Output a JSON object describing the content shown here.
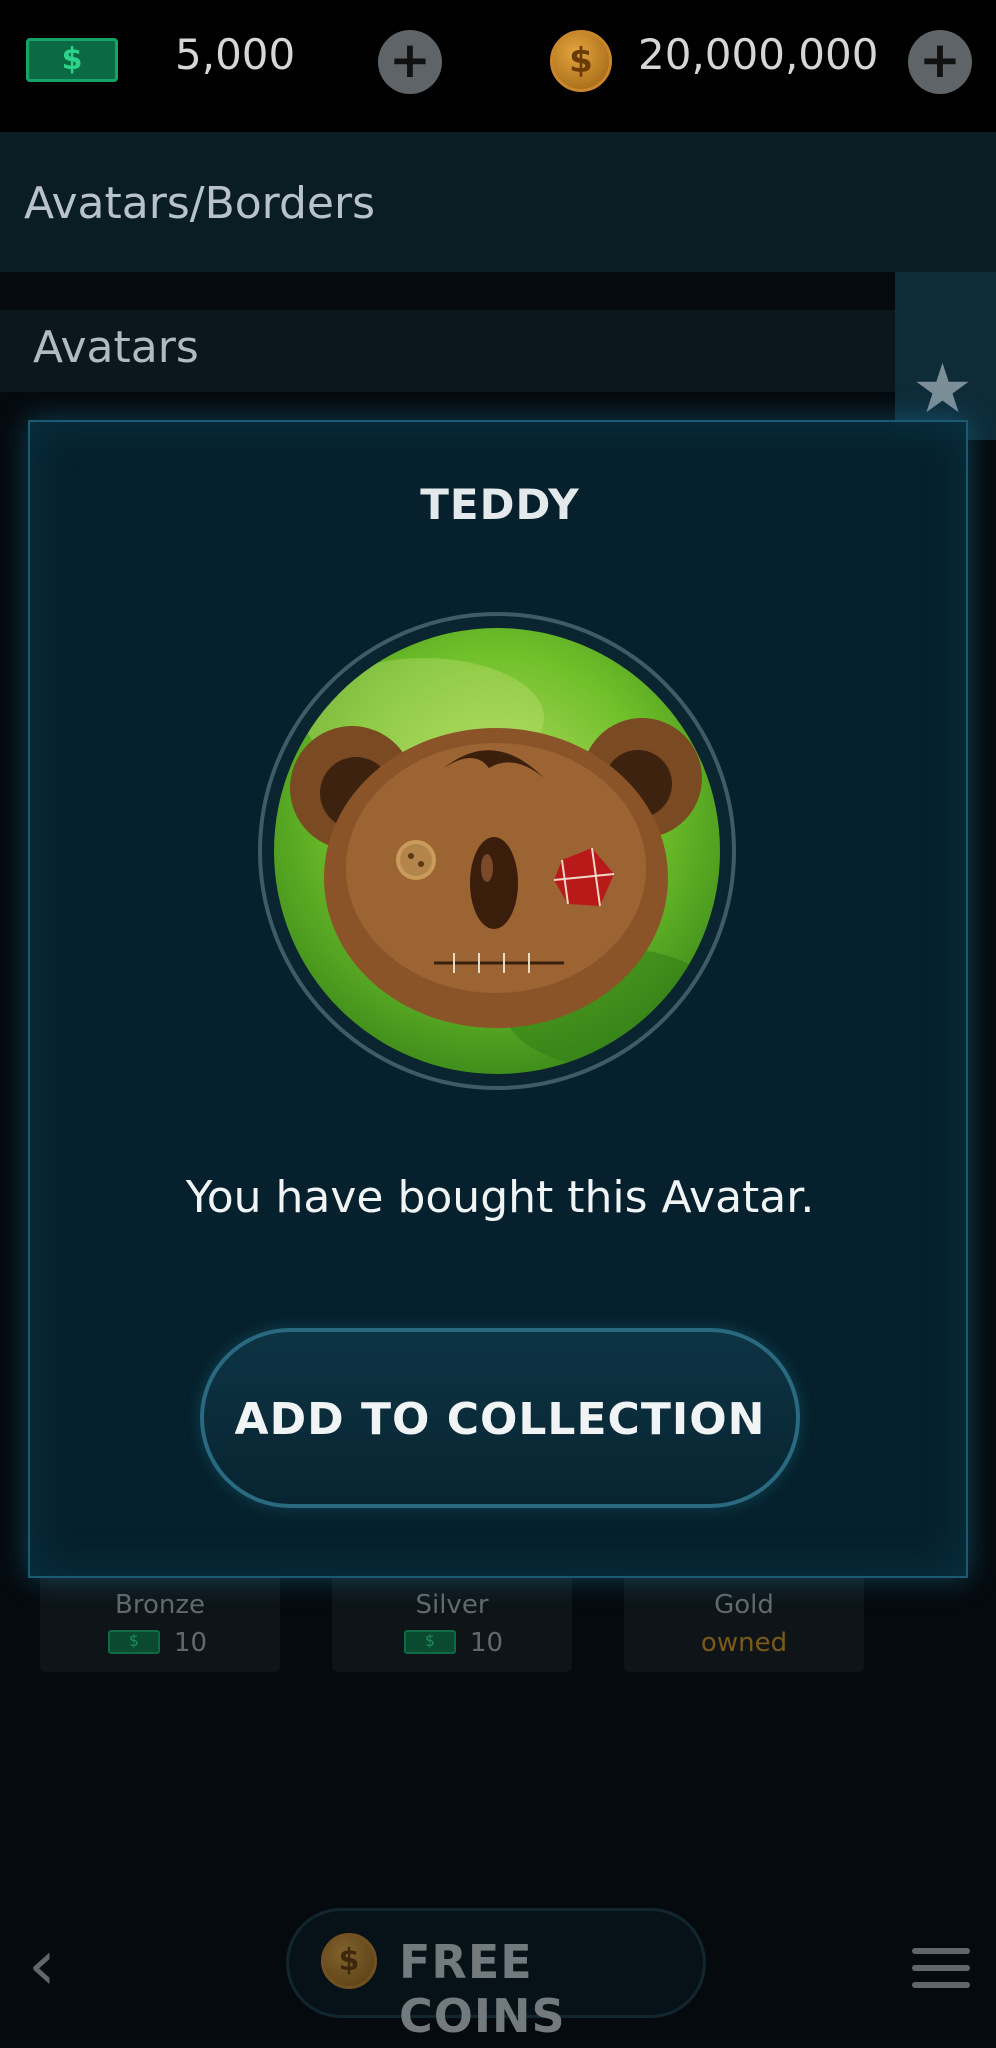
{
  "header": {
    "cash_symbol": "$",
    "cash_amount": "5,000",
    "coin_symbol": "$",
    "coins_amount": "20,000,000",
    "plus_symbol": "+"
  },
  "section": {
    "title": "Avatars/Borders",
    "subtitle": "Avatars",
    "star_glyph": "★"
  },
  "background_cards": [
    {
      "label": "Bronze",
      "price": "10",
      "owned": ""
    },
    {
      "label": "Silver",
      "price": "10",
      "owned": ""
    },
    {
      "label": "Gold",
      "price": "",
      "owned": "owned"
    }
  ],
  "modal": {
    "title": "TEDDY",
    "message": "You have bought this Avatar.",
    "button_label": "ADD TO COLLECTION",
    "avatar_icon": "teddy-bear-avatar"
  },
  "footer": {
    "back_glyph": "‹",
    "free_coins_label": "FREE COINS",
    "coin_symbol": "$"
  },
  "colors": {
    "cash_green": "#0b6a43",
    "coin_gold": "#e3a53c",
    "modal_bg": "#06243a",
    "modal_border": "#1a5a72",
    "owned_gold": "#7a5a16"
  }
}
